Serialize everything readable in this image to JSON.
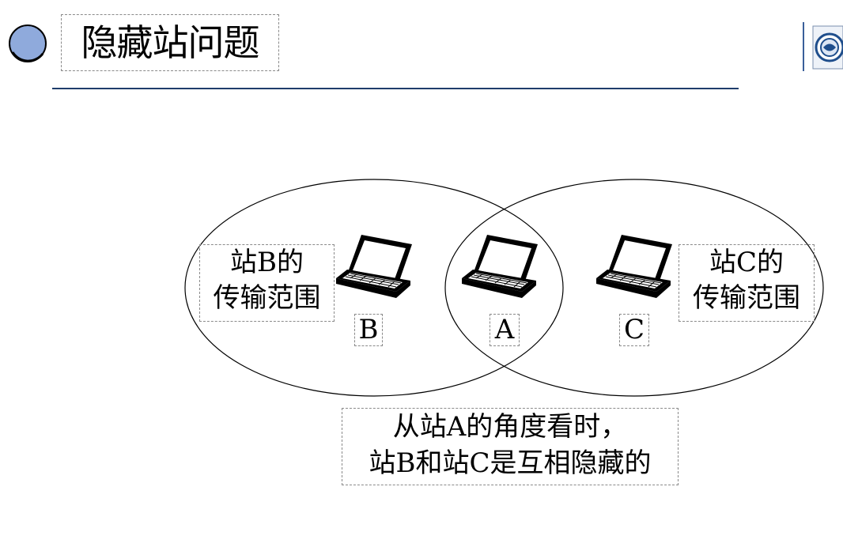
{
  "slide": {
    "title": "隐藏站问题",
    "title_color": "#000000",
    "bullet_color": "#8faadc",
    "rule_color": "#1f3d6b"
  },
  "diagram": {
    "stations": [
      {
        "label": "B",
        "range_label_line1": "站B的",
        "range_label_line2": "传输范围"
      },
      {
        "label": "A"
      },
      {
        "label": "C",
        "range_label_line1": "站C的",
        "range_label_line2": "传输范围"
      }
    ],
    "caption_line1": "从站A的角度看时，",
    "caption_line2": "站B和站C是互相隐藏的"
  },
  "icons": {
    "bullet": "circle-bullet-icon",
    "logo": "university-seal-icon",
    "station": "laptop-icon"
  }
}
